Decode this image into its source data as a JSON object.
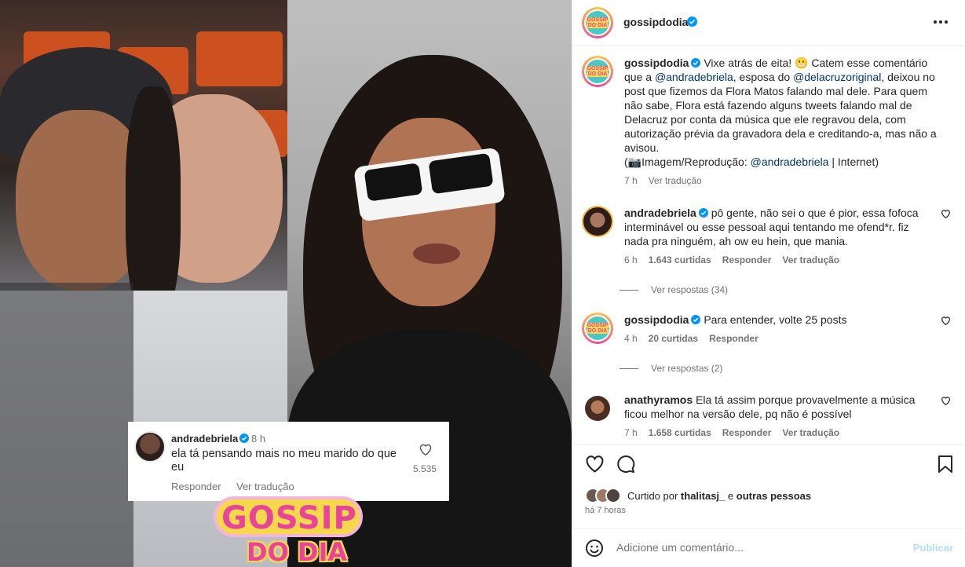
{
  "header": {
    "username": "gossipdodia",
    "avatar_text": [
      "GOSSIP",
      "DO DIA"
    ]
  },
  "caption": {
    "username": "gossipdodia",
    "text_1": "Vixe atrás de eita! 😬 Catem esse comentário que a ",
    "mention_1": "@andradebriela",
    "text_2": ", esposa do ",
    "mention_2": "@delacruzoriginal",
    "text_3": ", deixou no post que fizemos da Flora Matos falando mal dele. Para quem não sabe, Flora está fazendo alguns tweets falando mal de Delacruz por conta da música que ele regravou dela, com autorização prévia da gravadora dela e creditando-a, mas não a avisou.",
    "text_4": "(📷Imagem/Reprodução: ",
    "mention_3": "@andradebriela",
    "text_5": " | Internet)",
    "time": "7 h",
    "translate": "Ver tradução"
  },
  "comments": [
    {
      "username": "andradebriela",
      "text": "pô gente, não sei o que é pior, essa fofoca interminável ou esse pessoal aqui tentando me ofend*r. fiz nada pra ninguém, ah ow eu hein, que mania.",
      "time": "6 h",
      "likes": "1.643 curtidas",
      "reply": "Responder",
      "translate": "Ver tradução",
      "replies": "Ver respostas (34)"
    },
    {
      "username": "gossipdodia",
      "text": "Para entender, volte 25 posts",
      "time": "4 h",
      "likes": "20 curtidas",
      "reply": "Responder",
      "replies": "Ver respostas (2)"
    },
    {
      "username": "anathyramos",
      "text": "Ela tá assim porque provavelmente a música ficou melhor na versão dele, pq não é possível",
      "time": "7 h",
      "likes": "1.658 curtidas",
      "reply": "Responder",
      "translate": "Ver tradução"
    }
  ],
  "likes_section": {
    "prefix": "Curtido por ",
    "user": "thalitasj_",
    "middle": " e ",
    "others": "outras pessoas",
    "time": "há 7 horas"
  },
  "add_comment": {
    "placeholder": "Adicione um comentário...",
    "publish": "Publicar"
  },
  "media_card": {
    "username": "andradebriela",
    "time": "8 h",
    "text": "ela tá pensando mais no meu marido do que eu",
    "reply": "Responder",
    "translate": "Ver tradução",
    "likes": "5.535"
  },
  "media_logo": {
    "line1": "GOSSIP",
    "line2": "DO DIA"
  },
  "colors": {
    "verified": "#0095f6",
    "mention": "#00376b",
    "muted": "#737373",
    "publish_disabled": "#b2dffc"
  }
}
